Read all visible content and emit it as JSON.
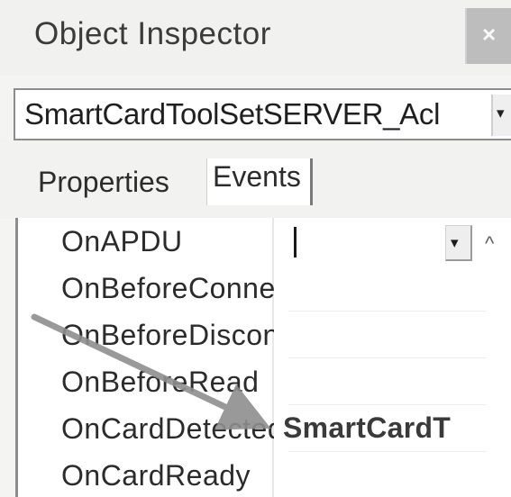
{
  "window": {
    "title": "Object Inspector",
    "close_glyph": "×"
  },
  "object_selector": {
    "value": "SmartCardToolSetSERVER_Acl",
    "dropdown_glyph": "▾"
  },
  "tabs": [
    {
      "label": "Properties",
      "active": false
    },
    {
      "label": "Events",
      "active": true
    }
  ],
  "events": [
    {
      "name": "OnAPDU",
      "value": ""
    },
    {
      "name": "OnBeforeConnect",
      "value": ""
    },
    {
      "name": "OnBeforeDisconnect",
      "value": ""
    },
    {
      "name": "OnBeforeRead",
      "value": ""
    },
    {
      "name": "OnCardDetected",
      "value": "SmartCardT"
    },
    {
      "name": "OnCardReady",
      "value": ""
    }
  ],
  "editor": {
    "dropdown_glyph": "▾",
    "scroll_glyph": "^"
  },
  "colors": {
    "annotation_arrow": "#8e8e8e",
    "close_button": "#bdbdbd"
  },
  "icons": [
    "close-icon",
    "dropdown-arrow-icon",
    "scroll-up-icon",
    "annotation-arrow-icon"
  ]
}
